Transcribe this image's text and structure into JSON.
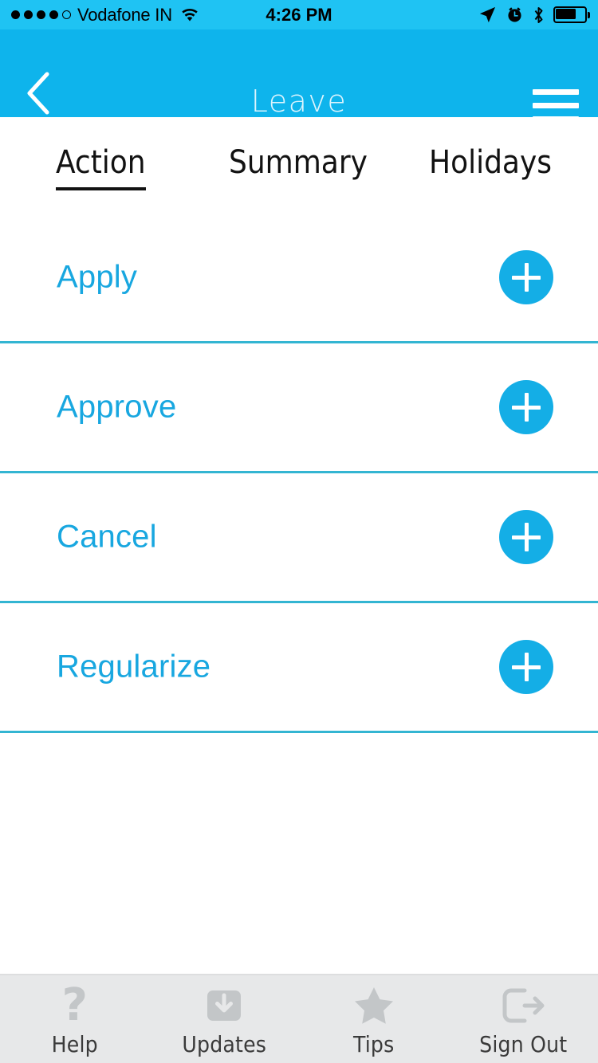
{
  "status_bar": {
    "carrier": "Vodafone IN",
    "time": "4:26 PM",
    "signal_dots_filled": 4,
    "signal_dots_total": 5,
    "wifi_icon": "wifi-icon",
    "location_icon": "location-arrow-icon",
    "alarm_icon": "alarm-clock-icon",
    "bluetooth_icon": "bluetooth-icon",
    "battery_icon": "battery-icon",
    "battery_percent": 66,
    "background_color": "#1FC3F3"
  },
  "nav_bar": {
    "title": "Leave",
    "back_icon": "chevron-left-icon",
    "menu_icon": "hamburger-menu-icon",
    "background_color": "#0EB4EC",
    "title_color": "#DCF4FD"
  },
  "tabs": {
    "items": [
      {
        "label": "Action",
        "active": true
      },
      {
        "label": "Summary",
        "active": false
      },
      {
        "label": "Holidays",
        "active": false
      }
    ]
  },
  "list": {
    "accent_color": "#18A7E0",
    "separator_color": "#33B5D2",
    "add_button_color": "#14AEE6",
    "rows": [
      {
        "label": "Apply",
        "action_icon": "plus-icon"
      },
      {
        "label": "Approve",
        "action_icon": "plus-icon"
      },
      {
        "label": "Cancel",
        "action_icon": "plus-icon"
      },
      {
        "label": "Regularize",
        "action_icon": "plus-icon"
      }
    ]
  },
  "tabbar": {
    "background_color": "#E7E8E9",
    "icon_color": "#C3C6C8",
    "label_color": "#3A3A3A",
    "items": [
      {
        "label": "Help",
        "icon": "question-mark-icon"
      },
      {
        "label": "Updates",
        "icon": "download-box-icon"
      },
      {
        "label": "Tips",
        "icon": "star-icon"
      },
      {
        "label": "Sign Out",
        "icon": "sign-out-icon"
      }
    ]
  }
}
